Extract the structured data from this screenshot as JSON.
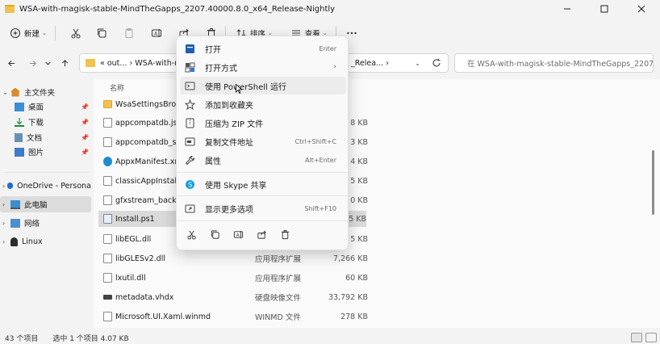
{
  "window": {
    "title": "WSA-with-magisk-stable-MindTheGapps_2207.40000.8.0_x64_Release-Nightly"
  },
  "toolbar": {
    "new_label": "新建",
    "sort_label": "排序",
    "view_label": "查看"
  },
  "address": {
    "crumbs": "« out... › WSA-with-m",
    "crumb_right": "_Relea... ›",
    "search_placeholder": "在 WSA-with-magisk-stable-MindTheGapps_2207...."
  },
  "sidebar": {
    "items": [
      {
        "label": "主文件夹"
      },
      {
        "label": "桌面"
      },
      {
        "label": "下载"
      },
      {
        "label": "文档"
      },
      {
        "label": "图片"
      },
      {
        "label": "OneDrive - Persona"
      },
      {
        "label": "此电脑"
      },
      {
        "label": "网络"
      },
      {
        "label": "Linux"
      }
    ]
  },
  "files": {
    "header_name": "名称",
    "rows": [
      {
        "name": "WsaSettingsBroke",
        "type": "",
        "size": ""
      },
      {
        "name": "appcompatdb.json",
        "type": "",
        "size": "8 KB"
      },
      {
        "name": "appcompatdb_sch",
        "type": "",
        "size": "3 KB"
      },
      {
        "name": "AppxManifest.xml",
        "type": "",
        "size": "4 KB"
      },
      {
        "name": "classicAppInstalle",
        "type": "",
        "size": "5 KB"
      },
      {
        "name": "gfxstream_backer",
        "type": "",
        "size": "0 KB"
      },
      {
        "name": "Install.ps1",
        "type": "",
        "size": "5 KB"
      },
      {
        "name": "libEGL.dll",
        "type": "",
        "size": "5 KB"
      },
      {
        "name": "libGLESv2.dll",
        "type": "应用程序扩展",
        "size": "7,266 KB"
      },
      {
        "name": "lxutil.dll",
        "type": "应用程序扩展",
        "size": "60 KB"
      },
      {
        "name": "metadata.vhdx",
        "type": "硬盘映像文件",
        "size": "33,792 KB"
      },
      {
        "name": "Microsoft.UI.Xaml.winmd",
        "type": "WINMD 文件",
        "size": "278 KB"
      }
    ]
  },
  "status": {
    "count": "43 个项目",
    "selection": "选中 1 个项目  4.07 KB"
  },
  "context_menu": {
    "items": [
      {
        "label": "打开",
        "shortcut": "Enter"
      },
      {
        "label": "打开方式",
        "shortcut": "›"
      },
      {
        "label": "使用 PowerShell 运行",
        "shortcut": ""
      },
      {
        "label": "添加到收藏夹",
        "shortcut": ""
      },
      {
        "label": "压缩为 ZIP 文件",
        "shortcut": ""
      },
      {
        "label": "复制文件地址",
        "shortcut": "Ctrl+Shift+C"
      },
      {
        "label": "属性",
        "shortcut": "Alt+Enter"
      },
      {
        "label": "使用 Skype 共享",
        "shortcut": ""
      },
      {
        "label": "显示更多选项",
        "shortcut": "Shift+F10"
      }
    ]
  },
  "colors": {
    "accent": "#0067c0",
    "selection": "#dadada",
    "folder": "#f2c14e"
  }
}
